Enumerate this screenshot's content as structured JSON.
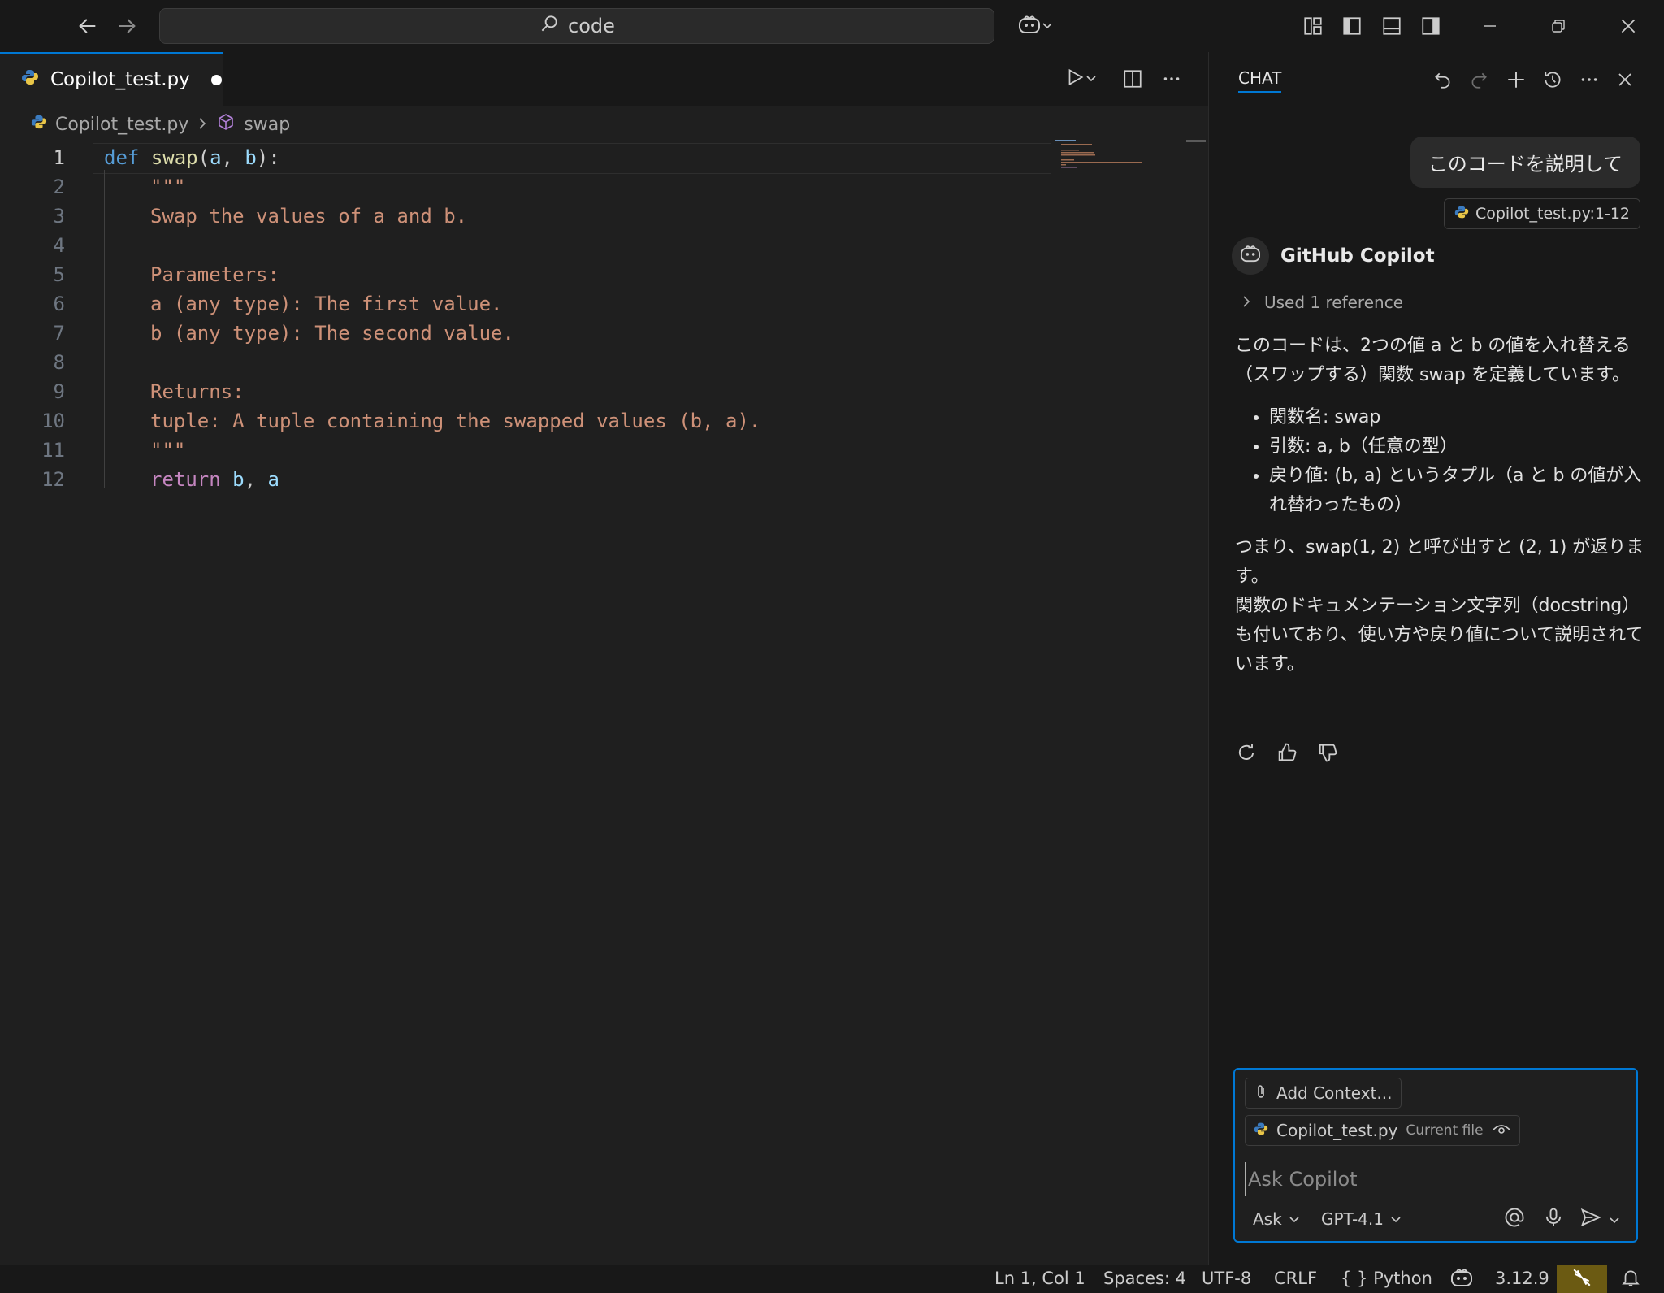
{
  "titlebar": {
    "search_text": "code",
    "icons": [
      "arrow-left-icon",
      "arrow-right-icon",
      "search-icon",
      "copilot-icon",
      "chevron-down-icon",
      "layout-customize-icon",
      "toggle-primary-sidebar-icon",
      "toggle-panel-icon",
      "toggle-secondary-sidebar-icon",
      "minimize-icon",
      "restore-icon",
      "close-icon"
    ]
  },
  "editor": {
    "tab_label": "Copilot_test.py",
    "breadcrumb": {
      "file": "Copilot_test.py",
      "symbol": "swap"
    },
    "lines": [
      {
        "n": "1"
      },
      {
        "n": "2"
      },
      {
        "n": "3"
      },
      {
        "n": "4"
      },
      {
        "n": "5"
      },
      {
        "n": "6"
      },
      {
        "n": "7"
      },
      {
        "n": "8"
      },
      {
        "n": "9"
      },
      {
        "n": "10"
      },
      {
        "n": "11"
      },
      {
        "n": "12"
      }
    ],
    "code": {
      "l1_def": "def",
      "l1_fn": "swap",
      "l1_paren_open": "(",
      "l1_a": "a",
      "l1_comma": ", ",
      "l1_b": "b",
      "l1_close": "):",
      "l2": "\"\"\"",
      "l3": "Swap the values of a and b.",
      "l5": "Parameters:",
      "l6": "a (any type): The first value.",
      "l7": "b (any type): The second value.",
      "l9": "Returns:",
      "l10": "tuple: A tuple containing the swapped values (b, a).",
      "l11": "\"\"\"",
      "l12_kw": "return",
      "l12_b": "b",
      "l12_comma": ", ",
      "l12_a": "a"
    }
  },
  "chat": {
    "title": "CHAT",
    "user_message": "このコードを説明して",
    "reference_chip": "Copilot_test.py:1-12",
    "assistant_name": "GitHub Copilot",
    "used_reference": "Used 1 reference",
    "response_intro": "このコードは、2つの値 a と b の値を入れ替える（スワップする）関数 swap を定義しています。",
    "bullets": [
      "関数名: swap",
      "引数: a, b（任意の型）",
      "戻り値: (b, a) というタプル（a と b の値が入れ替わったもの）"
    ],
    "response_outro_1": "つまり、swap(1, 2) と呼び出すと (2, 1) が返ります。",
    "response_outro_2": "関数のドキュメンテーション文字列（docstring）も付いており、使い方や戻り値について説明されています。",
    "input": {
      "add_context": "Add Context...",
      "file_chip": "Copilot_test.py",
      "file_chip_note": "Current file",
      "placeholder": "Ask Copilot",
      "mode": "Ask",
      "model": "GPT-4.1"
    }
  },
  "statusbar": {
    "position": "Ln 1, Col 1",
    "spaces": "Spaces: 4",
    "encoding": "UTF-8",
    "eol": "CRLF",
    "language": "Python",
    "language_icon": "{ }",
    "python_version": "3.12.9"
  },
  "colors": {
    "accent": "#0078d4",
    "keyword": "#569cd6",
    "function": "#dcdcaa",
    "parameter": "#9cdcfe",
    "string": "#ce9178",
    "control_keyword": "#c586c0"
  }
}
